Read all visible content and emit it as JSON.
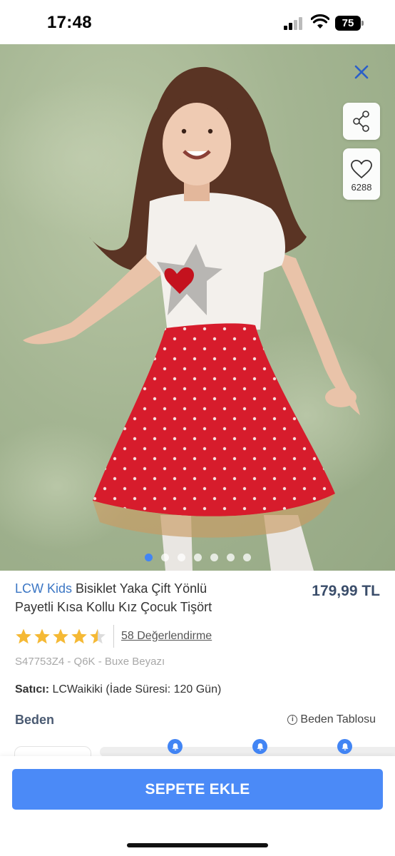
{
  "status_bar": {
    "time": "17:48",
    "battery": "75"
  },
  "hero": {
    "favorite_count": "6288",
    "carousel_dots": 7,
    "active_dot": 0
  },
  "product": {
    "brand": "LCW Kids",
    "name": " Bisiklet Yaka Çift Yönlü Payetli Kısa Kollu Kız Çocuk Tişört",
    "price": "179,99 TL",
    "rating": 4.5,
    "rating_max": 5,
    "reviews_label": "58 Değerlendirme",
    "sku": "S47753Z4 - Q6K - Buxe Beyazı",
    "seller_label": "Satıcı:",
    "seller_value": " LCWaikiki (İade Süresi: 120 Gün)"
  },
  "size_section": {
    "label": "Beden",
    "chart_link": "Beden Tablosu"
  },
  "cart": {
    "button_label": "SEPETE EKLE"
  },
  "colors": {
    "accent": "#4b8af7",
    "brand_text": "#3b76c4",
    "star": "#f5b935"
  }
}
